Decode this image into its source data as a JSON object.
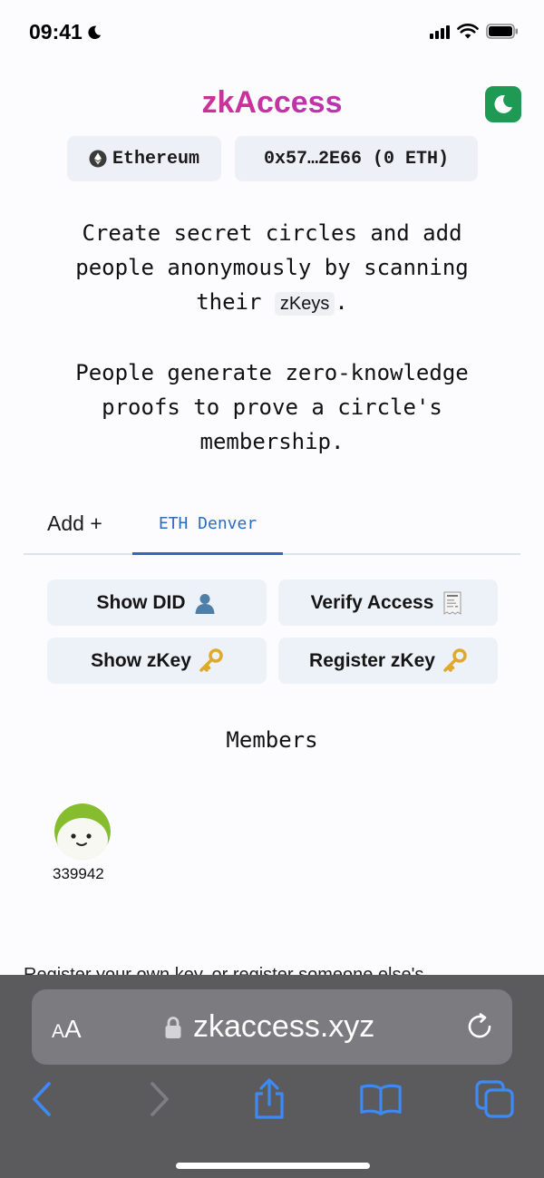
{
  "status_bar": {
    "time": "09:41"
  },
  "header": {
    "brand": "zkAccess"
  },
  "wallet": {
    "network": "Ethereum",
    "account": "0x57…2E66 (0 ETH)"
  },
  "intro": {
    "p1_before": "Create secret circles and add people anonymously by scanning their ",
    "p1_code": "zKeys",
    "p1_after": ".",
    "p2": "People generate zero-knowledge proofs to prove a circle's membership."
  },
  "tabs": [
    {
      "label": "Add +",
      "active": false
    },
    {
      "label": "ETH Denver",
      "active": true
    }
  ],
  "actions": [
    {
      "label": "Show DID",
      "icon": "bust-in-silhouette-icon"
    },
    {
      "label": "Verify Access",
      "icon": "receipt-icon"
    },
    {
      "label": "Show zKey",
      "icon": "key-icon"
    },
    {
      "label": "Register zKey",
      "icon": "key-icon"
    }
  ],
  "members": {
    "title": "Members",
    "items": [
      {
        "id": "339942"
      }
    ]
  },
  "footer_peek": "Register your own key, or register someone else's",
  "browser": {
    "aa": "AA",
    "url": "zkaccess.xyz"
  },
  "colors": {
    "accent": "#2c6cbf",
    "brand_start": "#d4317c",
    "brand_end": "#9a3bd6",
    "theme_button": "#1f9a55"
  }
}
